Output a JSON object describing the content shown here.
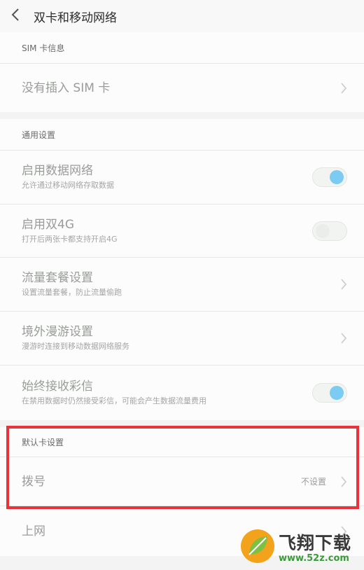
{
  "header": {
    "title": "双卡和移动网络"
  },
  "sim_info": {
    "title": "SIM 卡信息",
    "no_sim": "没有插入 SIM 卡"
  },
  "general": {
    "title": "通用设置",
    "items": [
      {
        "title": "启用数据网络",
        "subtitle": "允许通过移动网络存取数据",
        "control": "toggle",
        "on": true
      },
      {
        "title": "启用双4G",
        "subtitle": "打开后两张卡都支持开启4G",
        "control": "toggle",
        "on": false
      },
      {
        "title": "流量套餐设置",
        "subtitle": "设置流量套餐，防止流量偷跑",
        "control": "chevron"
      },
      {
        "title": "境外漫游设置",
        "subtitle": "漫游时连接到移动数据网络服务",
        "control": "chevron"
      },
      {
        "title": "始终接收彩信",
        "subtitle": "在禁用数据时仍然接受彩信，可能会产生数据流量费用",
        "control": "toggle",
        "on": true
      }
    ]
  },
  "default_card": {
    "title": "默认卡设置",
    "dial": {
      "label": "拨号",
      "value": "不设置"
    },
    "internet": {
      "label": "上网"
    }
  },
  "watermark": {
    "brand": "飞翔下载",
    "url": "www.52z.com"
  },
  "colors": {
    "toggle_on": "#7ccbf3",
    "highlight": "#e8333b"
  }
}
